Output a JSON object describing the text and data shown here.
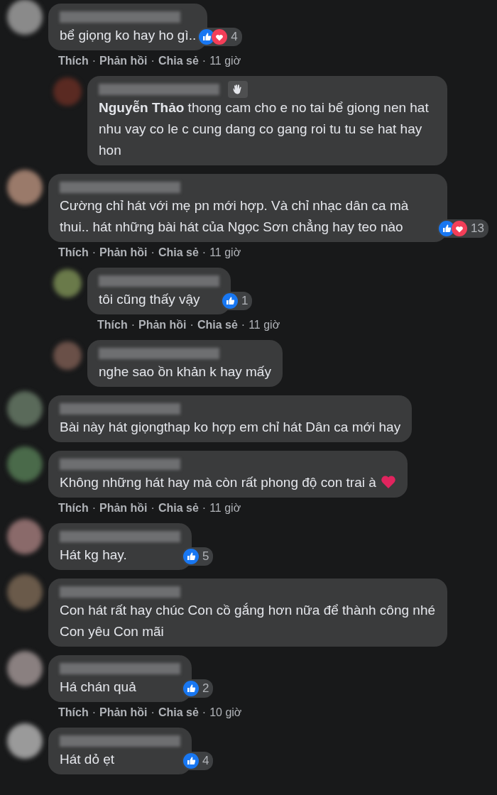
{
  "comments": [
    {
      "kind": "comment",
      "text": "bể giọng ko hay ho gì..",
      "like": true,
      "love": true,
      "count": "4",
      "actions": {
        "links": [
          "Thích",
          "Phản hồi",
          "Chia sẻ"
        ],
        "separator": "·",
        "time": "11 giờ"
      }
    },
    {
      "kind": "reply",
      "has_badge": true,
      "text": "**Nguyễn Thảo** thong cam cho e no tai bể giong nen hat nhu vay co le c cung dang co gang roi tu tu se hat hay hon"
    },
    {
      "kind": "comment",
      "text": "Cường chỉ hát với mẹ pn mới hợp. Và chỉ nhạc dân ca mà thui.. hát những bài hát của Ngọc Sơn chẳng hay teo nào",
      "like": true,
      "love": true,
      "count": "13",
      "actions": {
        "links": [
          "Thích",
          "Phản hồi",
          "Chia sẻ"
        ],
        "separator": "·",
        "time": "11 giờ"
      }
    },
    {
      "kind": "reply",
      "text": "tôi cũng thấy vậy",
      "like": true,
      "count": "1",
      "actions": {
        "links": [
          "Thích",
          "Phản hồi",
          "Chia sẻ"
        ],
        "separator": "·",
        "time": "11 giờ"
      }
    },
    {
      "kind": "reply",
      "text": "nghe sao ồn khản k hay mấy"
    },
    {
      "kind": "comment",
      "text": "Bài này hát giọngthap ko hợp em chỉ hát Dân ca mới hay"
    },
    {
      "kind": "comment",
      "text": "Không những hát hay mà còn rất phong độ con trai à",
      "has_heart_icon": true,
      "actions": {
        "links": [
          "Thích",
          "Phản hồi",
          "Chia sẻ"
        ],
        "separator": "·",
        "time": "11 giờ"
      }
    },
    {
      "kind": "comment",
      "text": "Hát kg hay.",
      "like": true,
      "count": "5"
    },
    {
      "kind": "comment",
      "text": "Con hát rất hay chúc Con cồ gắng hơn nữa để thành công nhé Con yêu Con mãi"
    },
    {
      "kind": "comment",
      "text": "Há chán quả",
      "like": true,
      "count": "2",
      "actions": {
        "links": [
          "Thích",
          "Phản hồi",
          "Chia sẻ"
        ],
        "separator": "·",
        "time": "10 giờ"
      }
    },
    {
      "kind": "comment",
      "text": "Hát dỏ ẹt",
      "like": true,
      "count": "4"
    }
  ]
}
